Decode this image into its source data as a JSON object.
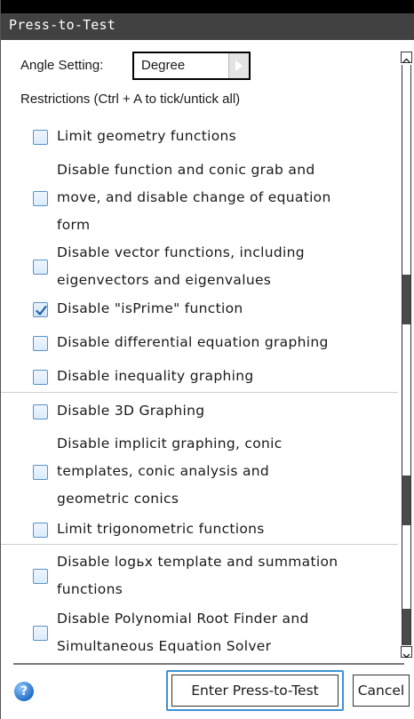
{
  "window": {
    "title": "Press-to-Test"
  },
  "angle": {
    "label": "Angle Setting:",
    "value": "Degree",
    "arrow_icon": "arrow-right-icon"
  },
  "restrictions": {
    "label": "Restrictions (Ctrl + A to tick/untick all)",
    "items": [
      {
        "lines": [
          "Limit geometry functions"
        ],
        "checked": false
      },
      {
        "lines": [
          "Disable function and conic grab and",
          "move, and disable change of equation",
          "form"
        ],
        "checked": false
      },
      {
        "lines": [
          "Disable vector functions, including",
          "eigenvectors and eigenvalues"
        ],
        "checked": false
      },
      {
        "lines": [
          "Disable \"isPrime\" function"
        ],
        "checked": true
      },
      {
        "lines": [
          "Disable differential equation graphing"
        ],
        "checked": false
      },
      {
        "lines": [
          "Disable inequality graphing"
        ],
        "checked": false
      },
      {
        "lines": [
          "Disable 3D Graphing"
        ],
        "checked": false
      },
      {
        "lines": [
          "Disable implicit graphing, conic",
          "templates, conic analysis and",
          "geometric conics"
        ],
        "checked": false
      },
      {
        "lines": [
          "Limit trigonometric functions"
        ],
        "checked": false
      },
      {
        "lines": [
          "Disable logьx template and summation",
          "functions"
        ],
        "checked": false
      },
      {
        "lines": [
          "Disable Polynomial Root Finder and",
          "Simultaneous Equation Solver"
        ],
        "checked": false
      }
    ]
  },
  "footer": {
    "help_icon": "help-icon",
    "help_glyph": "?",
    "enter_label": "Enter Press-to-Test",
    "cancel_label": "Cancel"
  }
}
